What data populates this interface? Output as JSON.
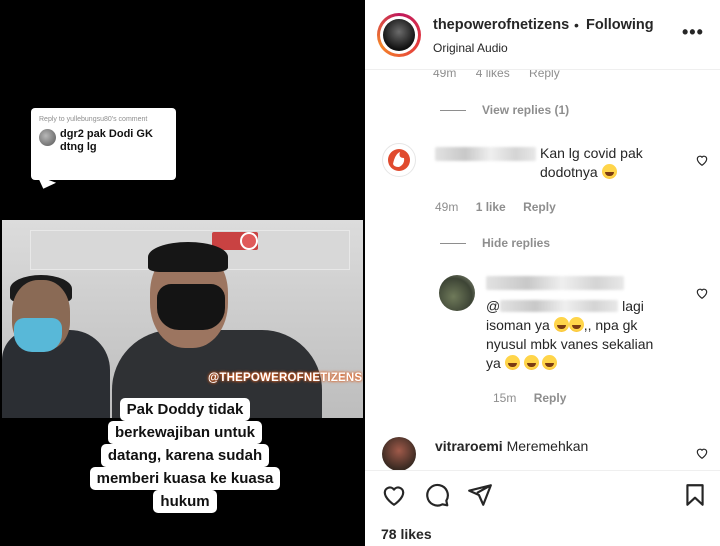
{
  "video": {
    "reply_card": {
      "header": "Reply to yullebungsu80's comment",
      "text": "dgr2 pak Dodi GK dtng lg"
    },
    "watermark": "@THEPOWEROFNETIZENS",
    "caption_lines": [
      "Pak Doddy tidak",
      "berkewajiban untuk",
      "datang, karena sudah",
      "memberi kuasa ke kuasa",
      "hukum"
    ]
  },
  "header": {
    "username": "thepowerofnetizens",
    "separator": "•",
    "follow_label": "Following",
    "audio_label": "Original Audio",
    "more_label": "•••"
  },
  "comments": {
    "cutoff_meta": {
      "time": "49m",
      "likes": "4 likes",
      "reply": "Reply"
    },
    "view_replies_label": "View replies (1)",
    "c1": {
      "text": "Kan lg covid pak dodotnya",
      "time": "49m",
      "likes": "1 like",
      "reply": "Reply"
    },
    "hide_replies_label": "Hide replies",
    "c2": {
      "mention": "@",
      "text_1": "lagi",
      "text_2": "isoman ya",
      "text_3": ",, npa gk",
      "text_4": "nyusul mbk vanes sekalian",
      "text_5": "ya",
      "time": "15m",
      "reply": "Reply"
    },
    "c3": {
      "username": "vitraroemi",
      "text": "Meremehkan"
    }
  },
  "footer": {
    "likes_label": "78 likes"
  },
  "colors": {
    "muted_text": "#8e8e8e",
    "primary_text": "#262626",
    "story_ring": "#c0185c"
  }
}
